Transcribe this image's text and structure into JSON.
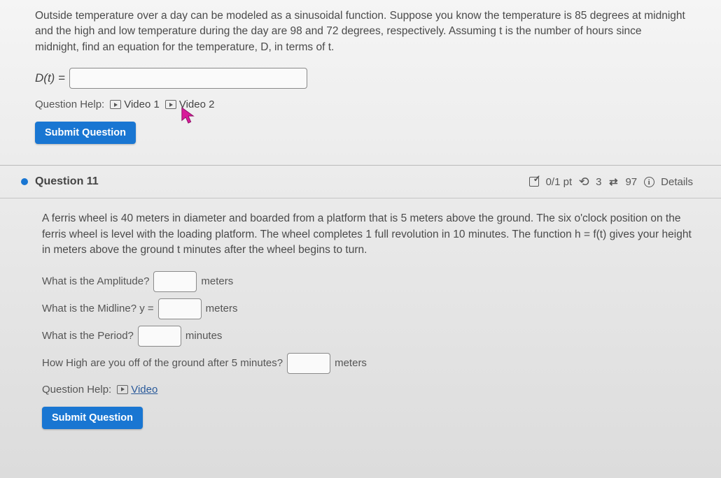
{
  "q10": {
    "prompt": "Outside temperature over a day can be modeled as a sinusoidal function. Suppose you know the temperature is 85 degrees at midnight and the high and low temperature during the day are 98 and 72 degrees, respectively. Assuming t is the number of hours since midnight, find an equation for the temperature, D, in terms of t.",
    "input_label": "D(t) =",
    "input_value": "",
    "help_label": "Question Help:",
    "video1": "Video 1",
    "video2": "Video 2",
    "submit": "Submit Question"
  },
  "q11": {
    "header_title": "Question 11",
    "score": "0/1 pt",
    "retries": "3",
    "attempts": "97",
    "details": "Details",
    "prompt": "A ferris wheel is 40 meters in diameter and boarded from a platform that is 5 meters above the ground. The six o'clock position on the ferris wheel is level with the loading platform. The wheel completes 1 full revolution in 10 minutes. The function h = f(t) gives your height in meters above the ground t minutes after the wheel begins to turn.",
    "amp_label": "What is the Amplitude?",
    "amp_unit": "meters",
    "mid_label": "What is the Midline? y =",
    "mid_unit": "meters",
    "per_label": "What is the Period?",
    "per_unit": "minutes",
    "high_label": "How High are you off of the ground after 5 minutes?",
    "high_unit": "meters",
    "help_label": "Question Help:",
    "video": "Video",
    "submit": "Submit Question",
    "amp_value": "",
    "mid_value": "",
    "per_value": "",
    "high_value": ""
  }
}
